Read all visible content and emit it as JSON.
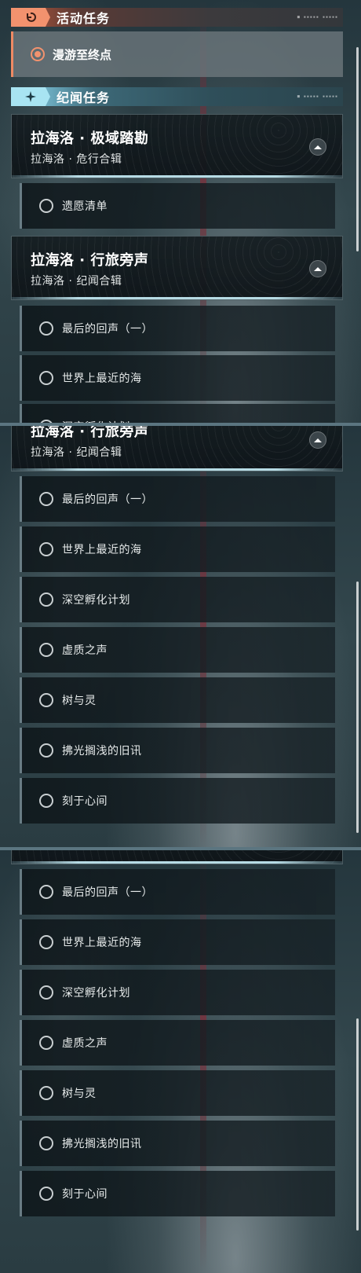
{
  "activity": {
    "header_title": "活动任务",
    "header_icon": "return-arrow-icon",
    "current_task": "漫游至终点",
    "accent_color": "#f2926e"
  },
  "story": {
    "header_title": "纪闻任务",
    "header_icon": "sparkle-icon",
    "accent_color": "#a8e4f2"
  },
  "chains": [
    {
      "title": "拉海洛 · 极域踏勘",
      "subtitle": "拉海洛 · 危行合辑",
      "tasks": [
        "遗愿清单"
      ]
    },
    {
      "title": "拉海洛 · 行旅旁声",
      "subtitle": "拉海洛 · 纪闻合辑",
      "tasks": [
        "最后的回声（一）",
        "世界上最近的海",
        "深空孵化计划",
        "虚质之声",
        "树与灵",
        "拂光搁浅的旧讯",
        "刻于心间"
      ]
    }
  ]
}
